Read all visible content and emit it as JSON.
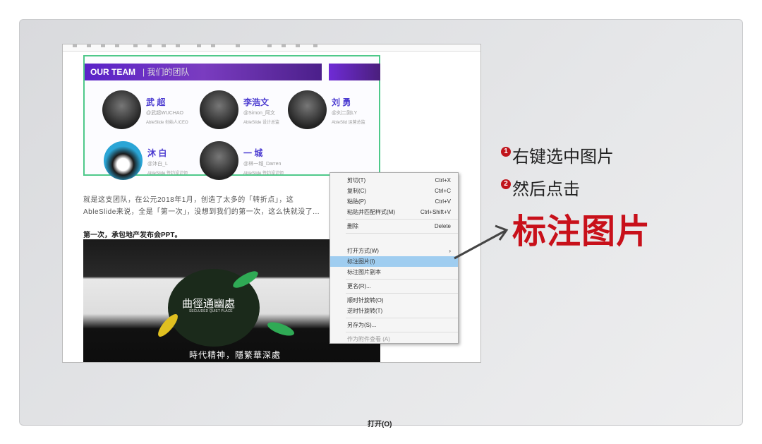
{
  "team": {
    "header_en": "OUR TEAM",
    "header_cn": "| 我们的团队",
    "members": [
      {
        "name": "武 超",
        "handle": "@武超WUCHAO",
        "role": "AbleSlide 创始人/CEO"
      },
      {
        "name": "李浩文",
        "handle": "@Simon_阿文",
        "role": "AbleSlide 设计总监"
      },
      {
        "name": "刘 勇",
        "handle": "@刘二刚LY",
        "role": "AbleSlid 运营总监"
      },
      {
        "name": "沐 白",
        "handle": "@沐白_L",
        "role": "AbleSlide 签约设计师"
      },
      {
        "name": "一 城",
        "handle": "@林一城_Darren",
        "role": "AbleSlide 签约设计师"
      }
    ]
  },
  "article": {
    "line1": "就是这支团队，在公元2018年1月，创造了太多的「转折点」，这",
    "line2": "AbleSlide来说，全是「第一次」，没想到我们的第一次，这么快就没了...",
    "heading": "第一次，承包地产发布会PPT。",
    "photo_title": "曲徑通幽處",
    "photo_sub": "SECLUDED QUIET PLACE",
    "photo_title2": "時代精神，隱繁華深處"
  },
  "context_menu": {
    "items": [
      {
        "label": "剪切(T)",
        "shortcut": "Ctrl+X"
      },
      {
        "label": "复制(C)",
        "shortcut": "Ctrl+C"
      },
      {
        "label": "粘贴(P)",
        "shortcut": "Ctrl+V"
      },
      {
        "label": "粘贴并匹配样式(M)",
        "shortcut": "Ctrl+Shift+V"
      },
      {
        "label": "删除",
        "shortcut": "Delete"
      },
      {
        "label": "打开(O)",
        "shortcut": ""
      },
      {
        "label": "打开方式(W)",
        "shortcut": "›"
      },
      {
        "label": "标注图片(I)",
        "shortcut": ""
      },
      {
        "label": "标注图片副本",
        "shortcut": ""
      },
      {
        "label": "更名(R)...",
        "shortcut": ""
      },
      {
        "label": "顺时针旋转(O)",
        "shortcut": ""
      },
      {
        "label": "逆时针旋转(T)",
        "shortcut": ""
      },
      {
        "label": "另存为(S)...",
        "shortcut": ""
      },
      {
        "label": "作为附件查看 (A)",
        "shortcut": ""
      }
    ]
  },
  "annotation": {
    "step1_num": "1",
    "step1": "右键选中图片",
    "step2_num": "2",
    "step2": "然后点击",
    "highlight": "标注图片"
  },
  "colors": {
    "accent_red": "#c8101a",
    "menu_highlight": "#9fcdf0",
    "team_purple": "#5a23c8"
  }
}
